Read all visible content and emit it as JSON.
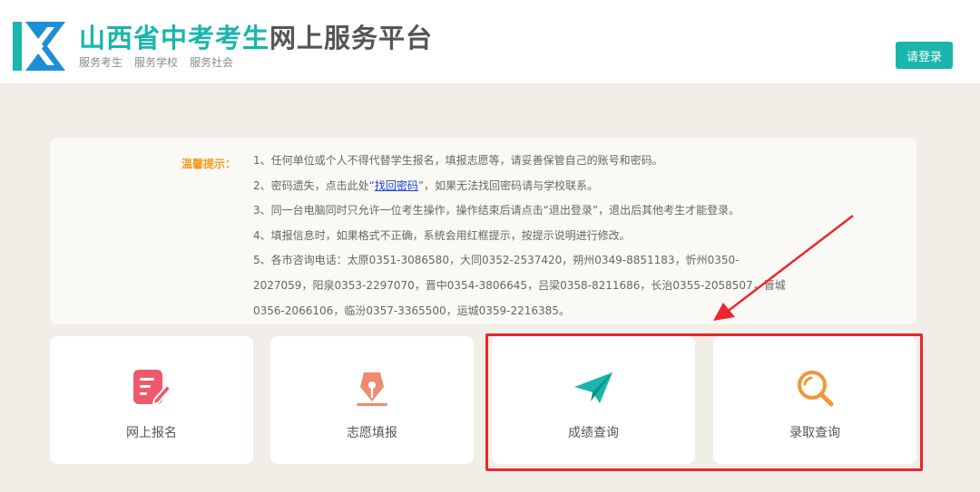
{
  "header": {
    "title_highlight": "山西省中考考生",
    "title_rest": "网上服务平台",
    "slogans": [
      "服务考生",
      "服务学校",
      "服务社会"
    ],
    "login_label": "请登录"
  },
  "notice": {
    "label": "温馨提示：",
    "line1": "1、任何单位或个人不得代替学生报名，填报志愿等，请妥善保管自己的账号和密码。",
    "line2_pre": "2、密码遗失，点击此处“",
    "line2_link": "找回密码",
    "line2_post": "”，如果无法找回密码请与学校联系。",
    "line3": "3、同一台电脑同时只允许一位考生操作，操作结束后请点击“退出登录”，退出后其他考生才能登录。",
    "line4": "4、填报信息时，如果格式不正确，系统会用红框提示，按提示说明进行修改。",
    "line5a": "5、各市咨询电话：太原0351-3086580，大同0352-2537420，朔州0349-8851183，忻州0350-",
    "line5b": "2027059，阳泉0353-2297070，晋中0354-3806645，吕梁0358-8211686，长治0355-2058507，晋城",
    "line5c": "0356-2066106，临汾0357-3365500，运城0359-2216385。"
  },
  "cards": [
    {
      "label": "网上报名",
      "icon": "form-pen-icon",
      "color": "#ee5a6c"
    },
    {
      "label": "志愿填报",
      "icon": "fountain-pen-icon",
      "color": "#f08a6e"
    },
    {
      "label": "成绩查询",
      "icon": "paper-plane-icon",
      "color": "#1ab5ad"
    },
    {
      "label": "录取查询",
      "icon": "magnifier-icon",
      "color": "#f2973a"
    }
  ],
  "colors": {
    "accent": "#1ab5ad",
    "notice_label": "#f39a1e",
    "annotation": "#e8282c"
  }
}
